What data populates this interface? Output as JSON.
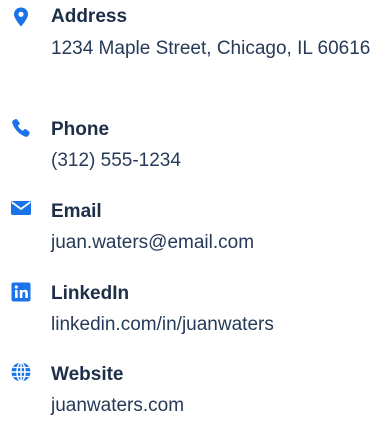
{
  "colors": {
    "accent": "#1a73e8",
    "heading": "#1d2e48",
    "text": "#263a57"
  },
  "contacts": [
    {
      "icon": "map-pin-icon",
      "label": "Address",
      "value": "1234 Maple Street, Chicago, IL 60616"
    },
    {
      "icon": "phone-icon",
      "label": "Phone",
      "value": "(312) 555-1234"
    },
    {
      "icon": "envelope-icon",
      "label": "Email",
      "value": "juan.waters@email.com"
    },
    {
      "icon": "linkedin-icon",
      "label": "LinkedIn",
      "value": "linkedin.com/in/juanwaters"
    },
    {
      "icon": "globe-icon",
      "label": "Website",
      "value": "juanwaters.com"
    }
  ]
}
